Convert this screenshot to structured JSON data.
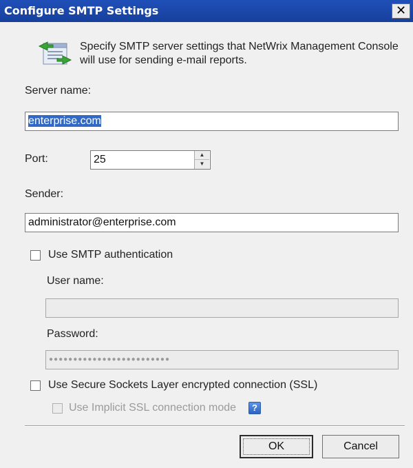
{
  "dialog": {
    "title": "Configure SMTP Settings",
    "close_glyph": "✕",
    "header_icon": "email-server-icon",
    "description": "Specify SMTP server settings that NetWrix Management Console will use for sending e-mail reports."
  },
  "server": {
    "label": "Server name:",
    "value": "enterprise.com"
  },
  "port": {
    "label": "Port:",
    "value": "25"
  },
  "sender": {
    "label": "Sender:",
    "value": "administrator@enterprise.com"
  },
  "auth": {
    "checkbox_label": "Use SMTP authentication",
    "checked": false,
    "username_label": "User name:",
    "username_value": "",
    "password_label": "Password:",
    "password_value": "●●●●●●●●●●●●●●●●●●●●●●●●●"
  },
  "ssl": {
    "checkbox_label": "Use Secure Sockets Layer encrypted connection (SSL)",
    "checked": false,
    "implicit_label": "Use Implicit SSL connection mode",
    "implicit_checked": false,
    "help_glyph": "?"
  },
  "buttons": {
    "ok": "OK",
    "cancel": "Cancel"
  },
  "colors": {
    "titlebar": "#1f4fb8",
    "selection": "#3169c6",
    "dialog_bg": "#f0f0f0"
  }
}
